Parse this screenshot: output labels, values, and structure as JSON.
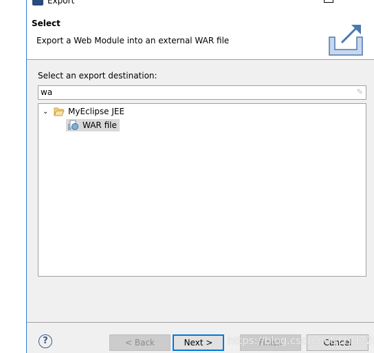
{
  "window": {
    "title": "Export",
    "minimize_icon": "minimize-icon",
    "maximize_icon": "maximize-icon",
    "close_icon": "close-icon"
  },
  "header": {
    "title": "Select",
    "description": "Export a Web Module into an external WAR file",
    "icon": "export-icon"
  },
  "main": {
    "label": "Select an export destination:",
    "filter": {
      "value": "wa",
      "clear_icon": "eraser-icon"
    },
    "tree": [
      {
        "label": "MyEclipse JEE",
        "expanded": true,
        "icon": "folder-open-icon",
        "children": [
          {
            "label": "WAR file",
            "icon": "war-file-icon",
            "selected": true
          }
        ]
      }
    ]
  },
  "footer": {
    "back": "< Back",
    "next": "Next >",
    "finish": "Finish",
    "cancel": "Cancel",
    "help_icon": "help-icon"
  },
  "watermark": "https://blog.csdn.net/LHH720",
  "colors": {
    "accent": "#0078d7",
    "selection": "#d9d9d9"
  }
}
